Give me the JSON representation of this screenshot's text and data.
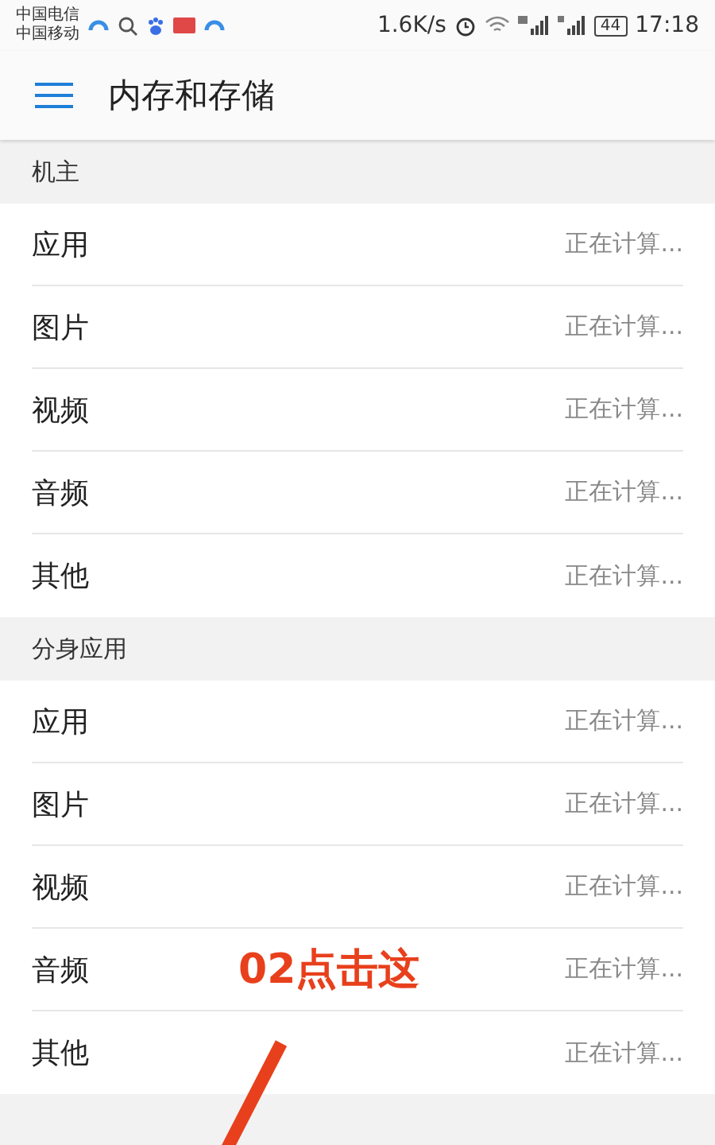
{
  "status_bar": {
    "carriers": [
      "中国电信",
      "中国移动"
    ],
    "speed": "1.6K/s",
    "battery": "44",
    "time": "17:18"
  },
  "app_bar": {
    "title": "内存和存储"
  },
  "sections": [
    {
      "header": "机主",
      "rows": [
        {
          "label": "应用",
          "value": "正在计算..."
        },
        {
          "label": "图片",
          "value": "正在计算..."
        },
        {
          "label": "视频",
          "value": "正在计算..."
        },
        {
          "label": "音频",
          "value": "正在计算..."
        },
        {
          "label": "其他",
          "value": "正在计算..."
        }
      ]
    },
    {
      "header": "分身应用",
      "rows": [
        {
          "label": "应用",
          "value": "正在计算..."
        },
        {
          "label": "图片",
          "value": "正在计算..."
        },
        {
          "label": "视频",
          "value": "正在计算..."
        },
        {
          "label": "音频",
          "value": "正在计算..."
        },
        {
          "label": "其他",
          "value": "正在计算..."
        }
      ]
    }
  ],
  "annotation": {
    "text": "02点击这"
  }
}
